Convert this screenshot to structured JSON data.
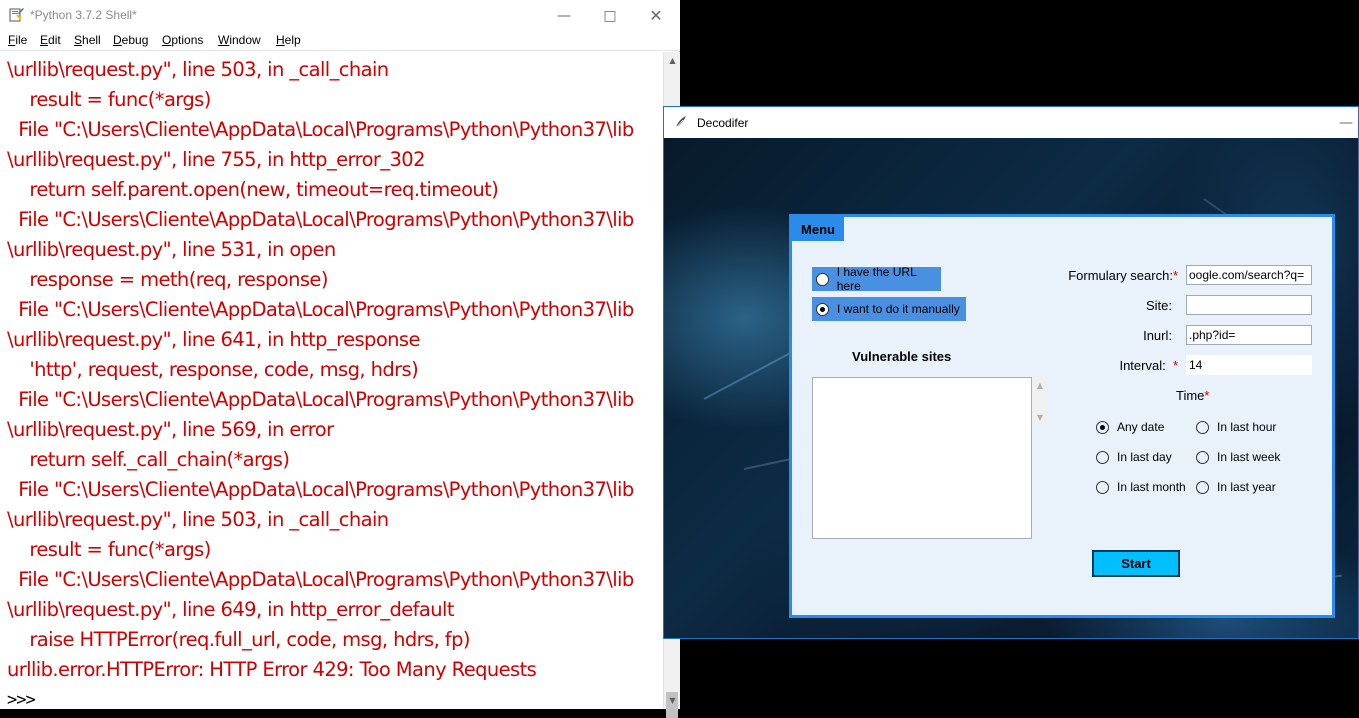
{
  "idle": {
    "title": "*Python 3.7.2 Shell*",
    "menu": [
      "File",
      "Edit",
      "Shell",
      "Debug",
      "Options",
      "Window",
      "Help"
    ],
    "menu_underline": [
      "F",
      "E",
      "S",
      "D",
      "O",
      "W",
      "H"
    ],
    "lines": [
      "\\urllib\\request.py\", line 503, in _call_chain",
      "    result = func(*args)",
      "  File \"C:\\Users\\Cliente\\AppData\\Local\\Programs\\Python\\Python37\\lib",
      "\\urllib\\request.py\", line 755, in http_error_302",
      "    return self.parent.open(new, timeout=req.timeout)",
      "  File \"C:\\Users\\Cliente\\AppData\\Local\\Programs\\Python\\Python37\\lib",
      "\\urllib\\request.py\", line 531, in open",
      "    response = meth(req, response)",
      "  File \"C:\\Users\\Cliente\\AppData\\Local\\Programs\\Python\\Python37\\lib",
      "\\urllib\\request.py\", line 641, in http_response",
      "    'http', request, response, code, msg, hdrs)",
      "  File \"C:\\Users\\Cliente\\AppData\\Local\\Programs\\Python\\Python37\\lib",
      "\\urllib\\request.py\", line 569, in error",
      "    return self._call_chain(*args)",
      "  File \"C:\\Users\\Cliente\\AppData\\Local\\Programs\\Python\\Python37\\lib",
      "\\urllib\\request.py\", line 503, in _call_chain",
      "    result = func(*args)",
      "  File \"C:\\Users\\Cliente\\AppData\\Local\\Programs\\Python\\Python37\\lib",
      "\\urllib\\request.py\", line 649, in http_error_default",
      "    raise HTTPError(req.full_url, code, msg, hdrs, fp)",
      "urllib.error.HTTPError: HTTP Error 429: Too Many Requests"
    ],
    "prompt": ">>> "
  },
  "deco": {
    "title": "Decodifer",
    "menu_tab": "Menu",
    "radio_url": "I have the URL here",
    "radio_manual": "I want to do it manually",
    "selected_mode": "manual",
    "vulnerable_title": "Vulnerable sites",
    "formulary_label": "Formulary search:",
    "formulary_value": "oogle.com/search?q=",
    "site_label": "Site:",
    "site_value": "",
    "inurl_label": "Inurl:",
    "inurl_value": ".php?id=",
    "interval_label": "Interval:",
    "interval_value": "14",
    "time_label": "Time",
    "required_mark": "*",
    "time_options": [
      "Any date",
      "In last hour",
      "In last day",
      "In last week",
      "In last month",
      "In last year"
    ],
    "time_selected": "Any date",
    "start_label": "Start"
  },
  "colors": {
    "error_text": "#d00000",
    "panel_border": "#2a8be8",
    "start_button": "#00bfff",
    "radio_bg": "#4a90e2"
  }
}
